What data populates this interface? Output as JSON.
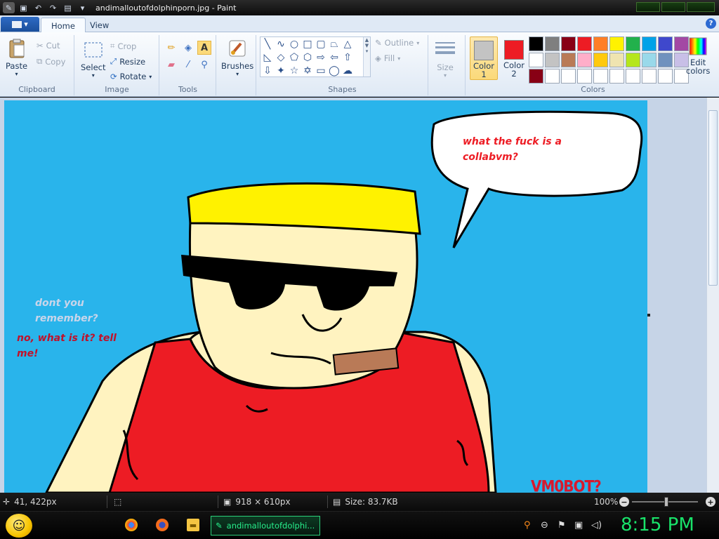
{
  "window": {
    "title": "andimalloutofdolphinporn.jpg - Paint"
  },
  "ribbon": {
    "tabs": [
      "Home",
      "View"
    ],
    "clipboard": {
      "paste": "Paste",
      "cut": "Cut",
      "copy": "Copy",
      "label": "Clipboard"
    },
    "image": {
      "select": "Select",
      "crop": "Crop",
      "resize": "Resize",
      "rotate": "Rotate",
      "label": "Image"
    },
    "tools": {
      "label": "Tools"
    },
    "brushes": {
      "label": "Brushes"
    },
    "shapes": {
      "outline": "Outline",
      "fill": "Fill",
      "label": "Shapes"
    },
    "size": {
      "label": "Size"
    },
    "colors": {
      "color1_label": "Color\n1",
      "color2_label": "Color\n2",
      "color1": "#c3c3c3",
      "color2": "#ed1c24",
      "edit_label": "Edit\ncolors",
      "label": "Colors",
      "palette": [
        "#000000",
        "#7f7f7f",
        "#880015",
        "#ed1c24",
        "#ff7f27",
        "#fff200",
        "#22b14c",
        "#00a2e8",
        "#3f48cc",
        "#a349a4",
        "#ffffff",
        "#c3c3c3",
        "#b97a57",
        "#ffaec9",
        "#ffc90e",
        "#efe4b0",
        "#b5e61d",
        "#99d9ea",
        "#7092be",
        "#c8bfe7",
        "#880015",
        "#ffffff",
        "#ffffff",
        "#ffffff",
        "#ffffff",
        "#ffffff",
        "#ffffff",
        "#ffffff",
        "#ffffff",
        "#ffffff"
      ]
    }
  },
  "canvas": {
    "background": "#29b4eb",
    "speech_top": [
      "what the fuck is a",
      "collabvm?"
    ],
    "speech_left_1": [
      "dont you",
      "remember?"
    ],
    "speech_left_2": [
      "no, what is it? tell",
      "me!"
    ],
    "signature": "VM0BOT?"
  },
  "statusbar": {
    "cursor_pos": "41, 422px",
    "dimensions": "918 × 610px",
    "size": "Size: 83.7KB",
    "zoom": "100%"
  },
  "taskbar": {
    "active_task": "andimalloutofdolphi...",
    "clock": "8:15 PM"
  }
}
